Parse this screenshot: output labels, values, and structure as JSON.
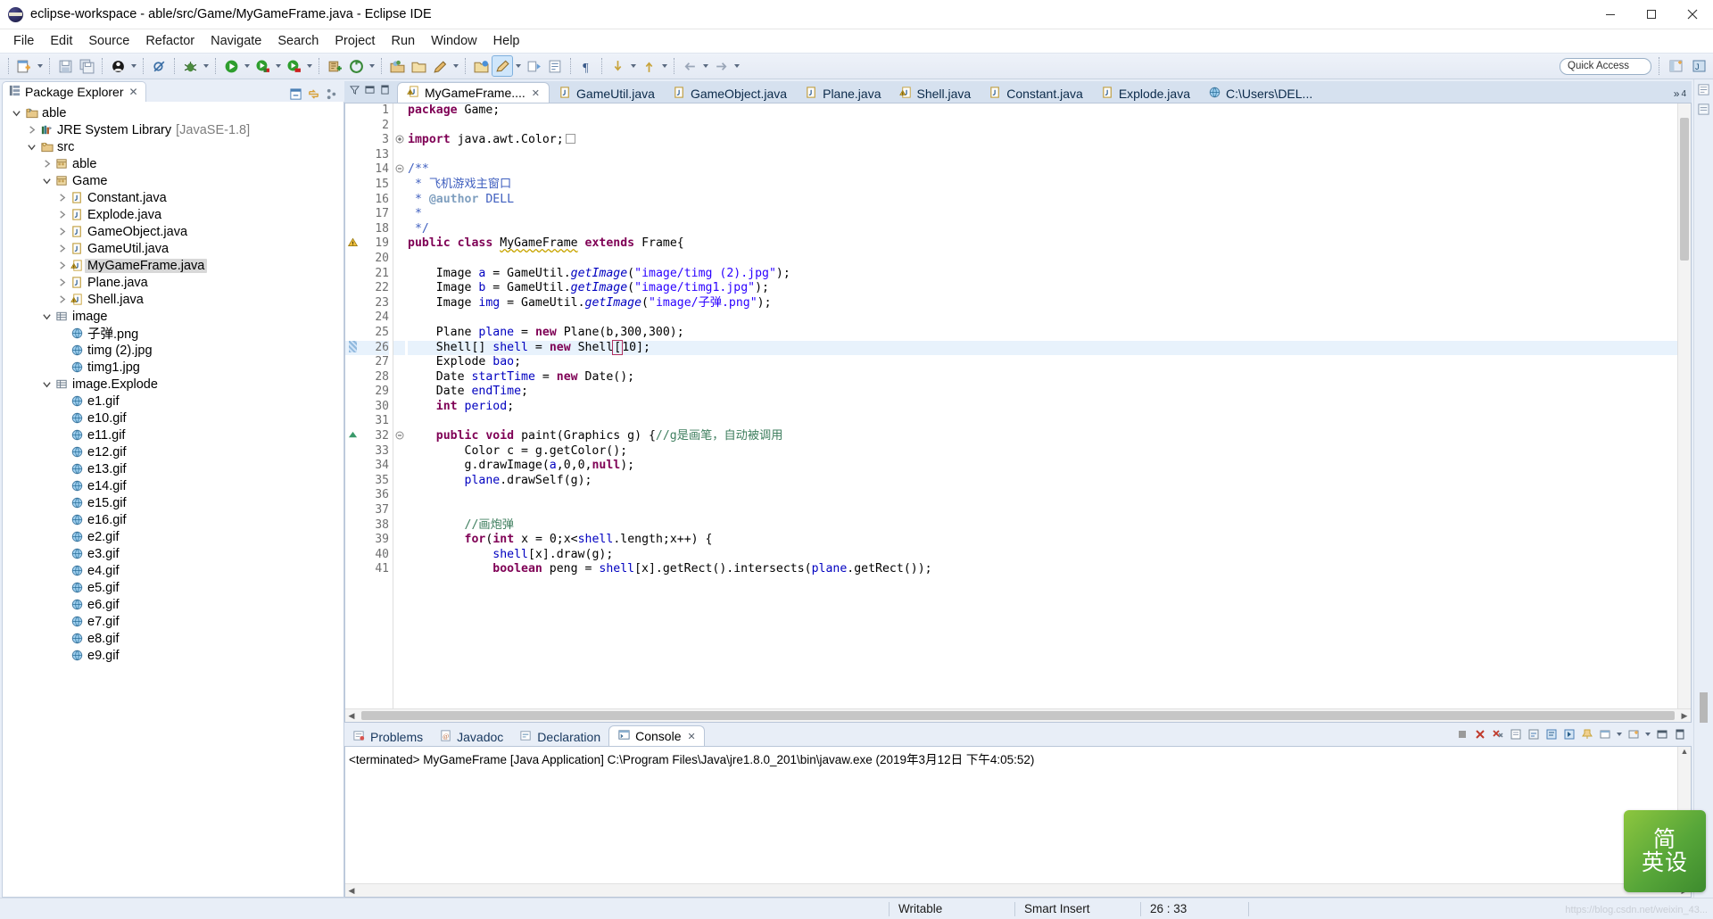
{
  "window": {
    "title": "eclipse-workspace - able/src/Game/MyGameFrame.java - Eclipse IDE",
    "minimize_label": "Minimize",
    "maximize_label": "Maximize",
    "close_label": "Close"
  },
  "menu": {
    "items": [
      {
        "label": "File"
      },
      {
        "label": "Edit"
      },
      {
        "label": "Source"
      },
      {
        "label": "Refactor"
      },
      {
        "label": "Navigate"
      },
      {
        "label": "Search"
      },
      {
        "label": "Project"
      },
      {
        "label": "Run"
      },
      {
        "label": "Window"
      },
      {
        "label": "Help"
      }
    ]
  },
  "toolbar": {
    "quick_access_placeholder": "Quick Access",
    "buttons": [
      {
        "name": "new-wizard",
        "icon": "new-file-icon"
      },
      {
        "name": "save",
        "icon": "save-icon"
      },
      {
        "name": "save-all",
        "icon": "save-all-icon"
      },
      {
        "name": "new-java-class",
        "icon": "java-class-icon"
      },
      {
        "name": "skip-breakpoints",
        "icon": "skip-breakpoints-icon"
      },
      {
        "name": "debug",
        "icon": "debug-bug-icon"
      },
      {
        "name": "run",
        "icon": "run-play-icon"
      },
      {
        "name": "run-coverage",
        "icon": "coverage-icon"
      },
      {
        "name": "run-external",
        "icon": "external-tools-icon"
      },
      {
        "name": "new-java-project",
        "icon": "new-project-icon"
      },
      {
        "name": "open-type",
        "icon": "open-type-icon"
      },
      {
        "name": "new-package",
        "icon": "package-icon"
      },
      {
        "name": "open-folder",
        "icon": "folder-icon"
      },
      {
        "name": "edit-pencil",
        "icon": "pencil-icon"
      },
      {
        "name": "toggle-mark-occurrences",
        "icon": "mark-occurrences-icon"
      },
      {
        "name": "annotate",
        "icon": "annotate-icon"
      },
      {
        "name": "last-edit-location",
        "icon": "last-edit-icon"
      },
      {
        "name": "next-annotation",
        "icon": "next-annotation-icon"
      },
      {
        "name": "previous-annotation",
        "icon": "previous-annotation-icon"
      },
      {
        "name": "back",
        "icon": "back-arrow-icon"
      },
      {
        "name": "forward",
        "icon": "forward-arrow-icon"
      }
    ]
  },
  "explorer": {
    "tab_label": "Package Explorer",
    "tab_close": "✕",
    "tools": [
      {
        "name": "collapse-all-icon"
      },
      {
        "name": "link-with-editor-icon"
      },
      {
        "name": "view-menu-icon"
      }
    ],
    "tree": [
      {
        "depth": 0,
        "twisty": "open",
        "icon": "java-project-icon",
        "label": "able",
        "sub": ""
      },
      {
        "depth": 1,
        "twisty": "closed",
        "icon": "library-icon",
        "label": "JRE System Library",
        "sub": "[JavaSE-1.8]"
      },
      {
        "depth": 1,
        "twisty": "open",
        "icon": "source-folder-icon",
        "label": "src",
        "sub": ""
      },
      {
        "depth": 2,
        "twisty": "closed",
        "icon": "package-icon",
        "label": "able",
        "sub": ""
      },
      {
        "depth": 2,
        "twisty": "open",
        "icon": "package-icon",
        "label": "Game",
        "sub": ""
      },
      {
        "depth": 3,
        "twisty": "closed",
        "icon": "java-file-icon",
        "label": "Constant.java",
        "sub": ""
      },
      {
        "depth": 3,
        "twisty": "closed",
        "icon": "java-file-icon",
        "label": "Explode.java",
        "sub": ""
      },
      {
        "depth": 3,
        "twisty": "closed",
        "icon": "java-file-icon",
        "label": "GameObject.java",
        "sub": ""
      },
      {
        "depth": 3,
        "twisty": "closed",
        "icon": "java-file-icon",
        "label": "GameUtil.java",
        "sub": ""
      },
      {
        "depth": 3,
        "twisty": "closed",
        "icon": "java-file-warning-icon",
        "label": "MyGameFrame.java",
        "sub": "",
        "selected": true
      },
      {
        "depth": 3,
        "twisty": "closed",
        "icon": "java-file-icon",
        "label": "Plane.java",
        "sub": ""
      },
      {
        "depth": 3,
        "twisty": "closed",
        "icon": "java-file-warning-icon",
        "label": "Shell.java",
        "sub": ""
      },
      {
        "depth": 2,
        "twisty": "open",
        "icon": "folder-package-icon",
        "label": "image",
        "sub": ""
      },
      {
        "depth": 3,
        "twisty": "none",
        "icon": "resource-icon",
        "label": "子弹.png",
        "sub": ""
      },
      {
        "depth": 3,
        "twisty": "none",
        "icon": "resource-icon",
        "label": "timg (2).jpg",
        "sub": ""
      },
      {
        "depth": 3,
        "twisty": "none",
        "icon": "resource-icon",
        "label": "timg1.jpg",
        "sub": ""
      },
      {
        "depth": 2,
        "twisty": "open",
        "icon": "folder-package-icon",
        "label": "image.Explode",
        "sub": ""
      },
      {
        "depth": 3,
        "twisty": "none",
        "icon": "resource-icon",
        "label": "e1.gif",
        "sub": ""
      },
      {
        "depth": 3,
        "twisty": "none",
        "icon": "resource-icon",
        "label": "e10.gif",
        "sub": ""
      },
      {
        "depth": 3,
        "twisty": "none",
        "icon": "resource-icon",
        "label": "e11.gif",
        "sub": ""
      },
      {
        "depth": 3,
        "twisty": "none",
        "icon": "resource-icon",
        "label": "e12.gif",
        "sub": ""
      },
      {
        "depth": 3,
        "twisty": "none",
        "icon": "resource-icon",
        "label": "e13.gif",
        "sub": ""
      },
      {
        "depth": 3,
        "twisty": "none",
        "icon": "resource-icon",
        "label": "e14.gif",
        "sub": ""
      },
      {
        "depth": 3,
        "twisty": "none",
        "icon": "resource-icon",
        "label": "e15.gif",
        "sub": ""
      },
      {
        "depth": 3,
        "twisty": "none",
        "icon": "resource-icon",
        "label": "e16.gif",
        "sub": ""
      },
      {
        "depth": 3,
        "twisty": "none",
        "icon": "resource-icon",
        "label": "e2.gif",
        "sub": ""
      },
      {
        "depth": 3,
        "twisty": "none",
        "icon": "resource-icon",
        "label": "e3.gif",
        "sub": ""
      },
      {
        "depth": 3,
        "twisty": "none",
        "icon": "resource-icon",
        "label": "e4.gif",
        "sub": ""
      },
      {
        "depth": 3,
        "twisty": "none",
        "icon": "resource-icon",
        "label": "e5.gif",
        "sub": ""
      },
      {
        "depth": 3,
        "twisty": "none",
        "icon": "resource-icon",
        "label": "e6.gif",
        "sub": ""
      },
      {
        "depth": 3,
        "twisty": "none",
        "icon": "resource-icon",
        "label": "e7.gif",
        "sub": ""
      },
      {
        "depth": 3,
        "twisty": "none",
        "icon": "resource-icon",
        "label": "e8.gif",
        "sub": ""
      },
      {
        "depth": 3,
        "twisty": "none",
        "icon": "resource-icon",
        "label": "e9.gif",
        "sub": ""
      }
    ]
  },
  "editor": {
    "left_controls": [
      {
        "name": "editor-filter-icon"
      },
      {
        "name": "editor-minimize-icon"
      },
      {
        "name": "editor-maximize-icon"
      }
    ],
    "tabs": [
      {
        "label": "MyGameFrame....",
        "icon": "java-file-warning-icon",
        "active": true,
        "close": "✕"
      },
      {
        "label": "GameUtil.java",
        "icon": "java-file-icon",
        "active": false
      },
      {
        "label": "GameObject.java",
        "icon": "java-file-icon",
        "active": false
      },
      {
        "label": "Plane.java",
        "icon": "java-file-icon",
        "active": false
      },
      {
        "label": "Shell.java",
        "icon": "java-file-warning-icon",
        "active": false
      },
      {
        "label": "Constant.java",
        "icon": "java-file-icon",
        "active": false
      },
      {
        "label": "Explode.java",
        "icon": "java-file-icon",
        "active": false
      },
      {
        "label": "C:\\Users\\DEL...",
        "icon": "resource-icon",
        "active": false
      }
    ],
    "overflow_label": "»",
    "overflow_count": "4",
    "lines": [
      {
        "n": "1",
        "fold": "",
        "ann": "",
        "html": "<span class=\"kw\">package</span> Game;"
      },
      {
        "n": "2",
        "fold": "",
        "ann": "",
        "html": ""
      },
      {
        "n": "3",
        "fold": "+",
        "ann": "",
        "html": "<span class=\"kw\">import</span> java.awt.Color;<span style=\"display:inline-block;width:11px;height:11px;border:1px solid #9a9a9a;vertical-align:-1px;margin-left:2px\"></span>"
      },
      {
        "n": "13",
        "fold": "",
        "ann": "",
        "html": ""
      },
      {
        "n": "14",
        "fold": "-",
        "ann": "",
        "html": "<span class=\"jdoc\">/**</span>"
      },
      {
        "n": "15",
        "fold": "",
        "ann": "",
        "html": "<span class=\"jdoc\"> * 飞机游戏主窗口</span>"
      },
      {
        "n": "16",
        "fold": "",
        "ann": "",
        "html": "<span class=\"jdoc\"> * </span><span class=\"jtag\">@author</span><span class=\"jdoc\"> DELL</span>"
      },
      {
        "n": "17",
        "fold": "",
        "ann": "",
        "html": "<span class=\"jdoc\"> * </span>"
      },
      {
        "n": "18",
        "fold": "",
        "ann": "",
        "html": "<span class=\"jdoc\"> */</span>"
      },
      {
        "n": "19",
        "fold": "",
        "ann": "warning",
        "html": "<span class=\"kw\">public</span> <span class=\"kw\">class</span> <span class=\"squiggle\">MyGameFrame</span> <span class=\"kw\">extends</span> Frame{"
      },
      {
        "n": "20",
        "fold": "",
        "ann": "",
        "html": ""
      },
      {
        "n": "21",
        "fold": "",
        "ann": "",
        "html": "    Image <span class=\"fld\">a</span> = GameUtil.<span class=\"sfld\">getImage</span>(<span class=\"str\">\"image/timg (2).jpg\"</span>);"
      },
      {
        "n": "22",
        "fold": "",
        "ann": "",
        "html": "    Image <span class=\"fld\">b</span> = GameUtil.<span class=\"sfld\">getImage</span>(<span class=\"str\">\"image/timg1.jpg\"</span>);"
      },
      {
        "n": "23",
        "fold": "",
        "ann": "",
        "html": "    Image <span class=\"fld\">img</span> = GameUtil.<span class=\"sfld\">getImage</span>(<span class=\"str\">\"image/子弹.png\"</span>);"
      },
      {
        "n": "24",
        "fold": "",
        "ann": "",
        "html": ""
      },
      {
        "n": "25",
        "fold": "",
        "ann": "",
        "html": "    Plane <span class=\"fld\">plane</span> = <span class=\"kw\">new</span> Plane(b,300,300);"
      },
      {
        "n": "26",
        "fold": "",
        "ann": "changed",
        "html": "    Shell[] <span class=\"fld\">shell</span> = <span class=\"kw\">new</span> Shell<span style=\"outline:1px solid #b03060;padding:0 1px\">[</span>10];",
        "highlight": true
      },
      {
        "n": "27",
        "fold": "",
        "ann": "",
        "html": "    Explode <span class=\"fld\">bao</span>;"
      },
      {
        "n": "28",
        "fold": "",
        "ann": "",
        "html": "    Date <span class=\"fld\">startTime</span> = <span class=\"kw\">new</span> Date();"
      },
      {
        "n": "29",
        "fold": "",
        "ann": "",
        "html": "    Date <span class=\"fld\">endTime</span>;"
      },
      {
        "n": "30",
        "fold": "",
        "ann": "",
        "html": "    <span class=\"kw\">int</span> <span class=\"fld\">period</span>;"
      },
      {
        "n": "31",
        "fold": "",
        "ann": "",
        "html": ""
      },
      {
        "n": "32",
        "fold": "-",
        "ann": "up",
        "html": "    <span class=\"kw\">public</span> <span class=\"kw\">void</span> paint(Graphics g) {<span class=\"cmt\">//g是画笔，自动被调用</span>"
      },
      {
        "n": "33",
        "fold": "",
        "ann": "",
        "html": "        Color c = g.getColor();"
      },
      {
        "n": "34",
        "fold": "",
        "ann": "",
        "html": "        g.drawImage(<span class=\"fld\">a</span>,0,0,<span class=\"kw\">null</span>);"
      },
      {
        "n": "35",
        "fold": "",
        "ann": "",
        "html": "        <span class=\"fld\">plane</span>.drawSelf(g);"
      },
      {
        "n": "36",
        "fold": "",
        "ann": "",
        "html": ""
      },
      {
        "n": "37",
        "fold": "",
        "ann": "",
        "html": ""
      },
      {
        "n": "38",
        "fold": "",
        "ann": "",
        "html": "        <span class=\"cmt\">//画炮弹</span>"
      },
      {
        "n": "39",
        "fold": "",
        "ann": "",
        "html": "        <span class=\"kw\">for</span>(<span class=\"kw\">int</span> x = 0;x&lt;<span class=\"fld\">shell</span>.length;x++) {"
      },
      {
        "n": "40",
        "fold": "",
        "ann": "",
        "html": "            <span class=\"fld\">shell</span>[x].draw(g);"
      },
      {
        "n": "41",
        "fold": "",
        "ann": "",
        "html": "            <span class=\"kw\">boolean</span> peng = <span class=\"fld\">shell</span>[x].getRect().intersects(<span class=\"fld\">plane</span>.getRect());"
      }
    ]
  },
  "console": {
    "tabs": [
      {
        "label": "Problems",
        "icon": "problems-icon",
        "active": false
      },
      {
        "label": "Javadoc",
        "icon": "javadoc-icon",
        "active": false
      },
      {
        "label": "Declaration",
        "icon": "declaration-icon",
        "active": false
      },
      {
        "label": "Console",
        "icon": "console-icon",
        "active": true,
        "close": "✕"
      }
    ],
    "tools": [
      {
        "name": "terminate-icon"
      },
      {
        "name": "remove-launch-icon"
      },
      {
        "name": "remove-all-terminated-icon"
      },
      {
        "name": "clear-console-icon"
      },
      {
        "name": "scroll-lock-icon"
      },
      {
        "name": "word-wrap-icon"
      },
      {
        "name": "show-console-on-output-icon"
      },
      {
        "name": "pin-console-icon"
      },
      {
        "name": "display-selected-console-icon"
      },
      {
        "name": "open-console-icon"
      },
      {
        "name": "console-view-menu-icon"
      },
      {
        "name": "console-minimize-icon"
      },
      {
        "name": "console-maximize-icon"
      }
    ],
    "output": "<terminated> MyGameFrame [Java Application] C:\\Program Files\\Java\\jre1.8.0_201\\bin\\javaw.exe (2019年3月12日 下午4:05:52)"
  },
  "statusbar": {
    "writable": "Writable",
    "insert_mode": "Smart Insert",
    "position": "26 : 33"
  },
  "watermark": {
    "line1": "简",
    "line2": "英设",
    "url": "https://blog.csdn.net/weixin_43..."
  },
  "colors": {
    "accent": "#2a00ff",
    "keyword": "#7f0055",
    "comment": "#3f7f5f",
    "javadoc": "#3f5fbf",
    "field": "#0000c0",
    "chrome": "#e8eef7",
    "selection": "#e8f2fc"
  }
}
